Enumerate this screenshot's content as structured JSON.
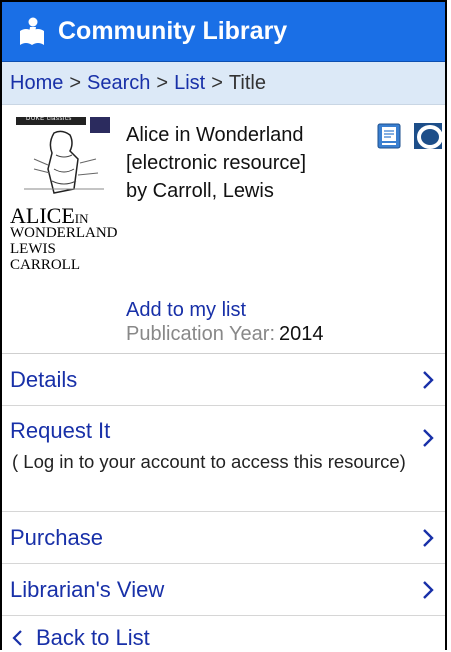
{
  "header": {
    "title": "Community Library",
    "logo_icon": "reader-icon",
    "accent": "#1a6fe6"
  },
  "breadcrumb": {
    "home": "Home",
    "search": "Search",
    "list": "List",
    "current": "Title",
    "separator": ">"
  },
  "item": {
    "cover": {
      "band_text": "DUKE classics",
      "title_big": "ALICE",
      "title_in": "IN",
      "title_line2": "WONDERLAND",
      "author_line": "LEWIS CARROLL"
    },
    "title_line1": "Alice in Wonderland",
    "title_line2": "[electronic resource]",
    "author": "by Carroll, Lewis",
    "pub_label": "Publication Year:",
    "pub_value": "2014",
    "format_icons": [
      "ebook-icon",
      "overdrive-icon"
    ],
    "add_to_list": "Add to my list"
  },
  "menu": {
    "details": "Details",
    "request": "Request It",
    "request_note": "( Log in to your account to access this resource)",
    "purchase": "Purchase",
    "librarian": "Librarian's View",
    "back": "Back to List"
  }
}
